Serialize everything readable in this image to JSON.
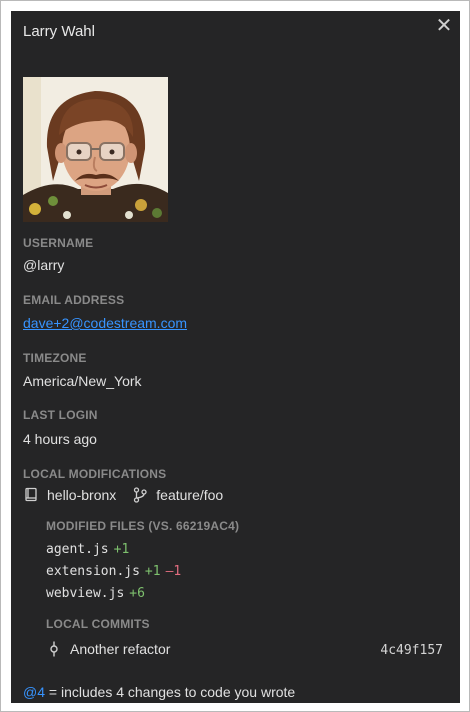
{
  "profile": {
    "name": "Larry Wahl",
    "fields": {
      "username_label": "USERNAME",
      "username": "@larry",
      "email_label": "EMAIL ADDRESS",
      "email": "dave+2@codestream.com",
      "timezone_label": "TIMEZONE",
      "timezone": "America/New_York",
      "last_login_label": "LAST LOGIN",
      "last_login": "4 hours ago"
    }
  },
  "local_mods": {
    "label": "LOCAL MODIFICATIONS",
    "repo": "hello-bronx",
    "branch": "feature/foo",
    "modified_files_label": "MODIFIED FILES (VS. 66219AC4)",
    "files": [
      {
        "name": "agent.js",
        "added": "+1",
        "removed": ""
      },
      {
        "name": "extension.js",
        "added": "+1",
        "removed": "–1"
      },
      {
        "name": "webview.js",
        "added": "+6",
        "removed": ""
      }
    ],
    "commits_label": "LOCAL COMMITS",
    "commits": [
      {
        "message": "Another refactor",
        "sha": "4c49f157"
      }
    ]
  },
  "footer": {
    "mention": "@4",
    "text": " = includes 4 changes to code you wrote"
  },
  "icons": {
    "close": "close-icon",
    "repo": "repo-icon",
    "branch": "git-branch-icon",
    "commit": "git-commit-icon"
  },
  "colors": {
    "background": "#252526",
    "link": "#3794ff",
    "added": "#7ec16e",
    "removed": "#e26d7f"
  }
}
